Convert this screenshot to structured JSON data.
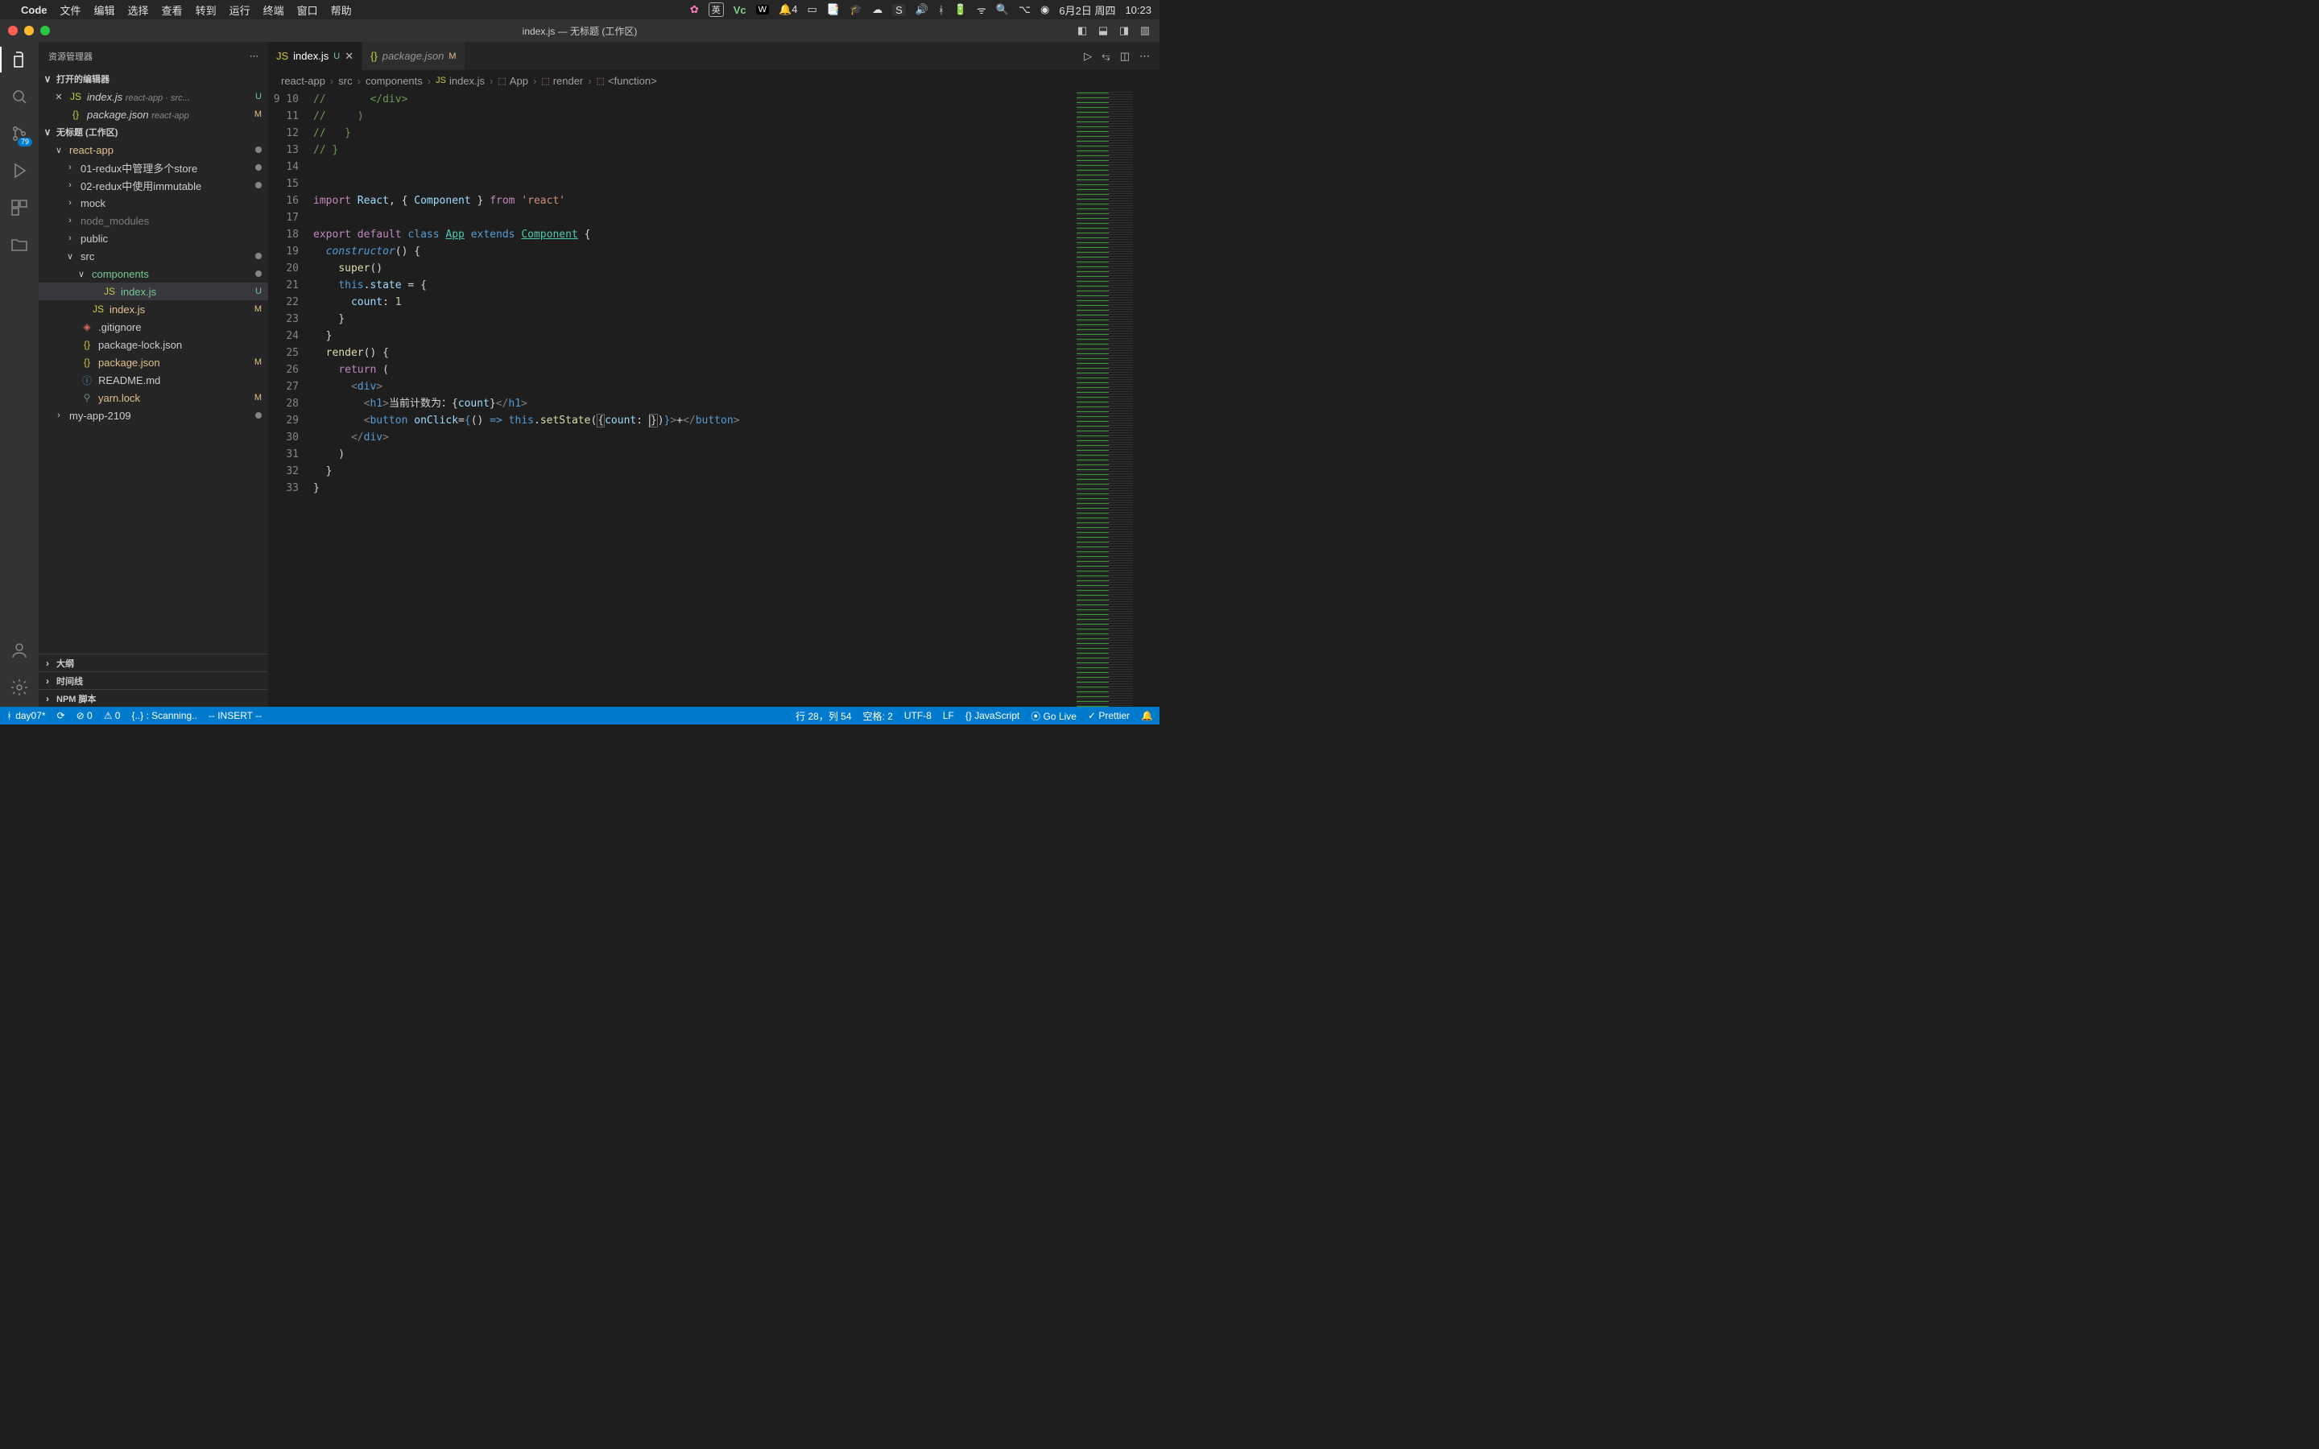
{
  "mac_menu": {
    "apple": "",
    "app": "Code",
    "items": [
      "文件",
      "编辑",
      "选择",
      "查看",
      "转到",
      "运行",
      "终端",
      "窗口",
      "帮助"
    ],
    "right": {
      "flower": "✿",
      "ime": "英",
      "vc": "Vc",
      "wf": "W",
      "bell": "🔔4",
      "tabs": "▭",
      "book": "📑",
      "hat": "🎓",
      "cloud": "☁",
      "s": "S",
      "vol": "🔊",
      "bt": "ᚼ",
      "bat": "🔋",
      "wifi": "ᯤ",
      "search": "🔍",
      "ctrl": "⌥",
      "siri": "◉",
      "date": "6月2日 周四",
      "time": "10:23"
    }
  },
  "titlebar": {
    "title": "index.js — 无标题 (工作区)"
  },
  "activitybar": {
    "scm_badge": "79"
  },
  "sidebar": {
    "title": "资源管理器",
    "open_editors_title": "打开的编辑器",
    "open_editors": [
      {
        "icon": "JS",
        "name": "index.js",
        "hint": "react-app · src...",
        "status": "U",
        "close": true
      },
      {
        "icon": "{}",
        "name": "package.json",
        "hint": "react-app",
        "status": "M",
        "close": false
      }
    ],
    "workspace_title": "无标题 (工作区)",
    "tree": [
      {
        "depth": 1,
        "chev": "∨",
        "icon": "",
        "name": "react-app",
        "cls": "lbl-mod",
        "dot": true
      },
      {
        "depth": 2,
        "chev": "›",
        "icon": "",
        "name": "01-redux中管理多个store",
        "dot": true
      },
      {
        "depth": 2,
        "chev": "›",
        "icon": "",
        "name": "02-redux中使用immutable",
        "dot": true
      },
      {
        "depth": 2,
        "chev": "›",
        "icon": "",
        "name": "mock"
      },
      {
        "depth": 2,
        "chev": "›",
        "icon": "",
        "name": "node_modules",
        "dim": true
      },
      {
        "depth": 2,
        "chev": "›",
        "icon": "",
        "name": "public"
      },
      {
        "depth": 2,
        "chev": "∨",
        "icon": "",
        "name": "src",
        "dot": true
      },
      {
        "depth": 3,
        "chev": "∨",
        "icon": "",
        "name": "components",
        "cls": "lbl-git",
        "dot": true
      },
      {
        "depth": 4,
        "icon": "JS",
        "iconcls": "ficon-js",
        "name": "index.js",
        "cls": "lbl-git",
        "status": "U",
        "active": true
      },
      {
        "depth": 3,
        "icon": "JS",
        "iconcls": "ficon-js",
        "name": "index.js",
        "cls": "lbl-mod",
        "status": "M"
      },
      {
        "depth": 2,
        "icon": "◈",
        "iconcls": "ficon-git",
        "name": ".gitignore"
      },
      {
        "depth": 2,
        "icon": "{}",
        "iconcls": "ficon-json",
        "name": "package-lock.json"
      },
      {
        "depth": 2,
        "icon": "{}",
        "iconcls": "ficon-json",
        "name": "package.json",
        "cls": "lbl-mod",
        "status": "M"
      },
      {
        "depth": 2,
        "icon": "ⓘ",
        "iconcls": "ficon-md",
        "name": "README.md"
      },
      {
        "depth": 2,
        "icon": "⚲",
        "iconcls": "ficon-lock",
        "name": "yarn.lock",
        "cls": "lbl-mod",
        "status": "M"
      },
      {
        "depth": 1,
        "chev": "›",
        "icon": "",
        "name": "my-app-2109",
        "dot": true
      }
    ],
    "sections": [
      "大纲",
      "时间线",
      "NPM 脚本"
    ]
  },
  "tabs": [
    {
      "icon": "JS",
      "name": "index.js",
      "status": "U",
      "italic": false,
      "active": true,
      "close": true
    },
    {
      "icon": "{}",
      "name": "package.json",
      "status": "M",
      "italic": true,
      "active": false,
      "close": false
    }
  ],
  "breadcrumbs": [
    "react-app",
    "src",
    "components",
    "index.js",
    "App",
    "render",
    "<function>"
  ],
  "code": {
    "first_line": 9,
    "lines": [
      "//       </div>",
      "//     )",
      "//   }",
      "// }",
      "",
      "",
      "import React, { Component } from 'react'",
      "",
      "export default class App extends Component {",
      "  constructor() {",
      "    super()",
      "    this.state = {",
      "      count: 1",
      "    }",
      "  }",
      "  render() {",
      "    return (",
      "      <div>",
      "        <h1>当前计数为：{count}</h1>",
      "        <button onClick={() => this.setState({count: })}>+</button>",
      "      </div>",
      "    )",
      "  }",
      "}",
      ""
    ],
    "highlight_line": 28
  },
  "statusbar": {
    "branch": "day07*",
    "sync": "⟳",
    "errors": "⊘ 0",
    "warnings": "⚠ 0",
    "scanning": "{..} : Scanning..",
    "mode": "-- INSERT --",
    "position": "行 28，列 54",
    "spaces": "空格: 2",
    "encoding": "UTF-8",
    "eol": "LF",
    "lang": "{} JavaScript",
    "golive": "⦿ Go Live",
    "prettier": "✓ Prettier",
    "bell": "🔔"
  }
}
